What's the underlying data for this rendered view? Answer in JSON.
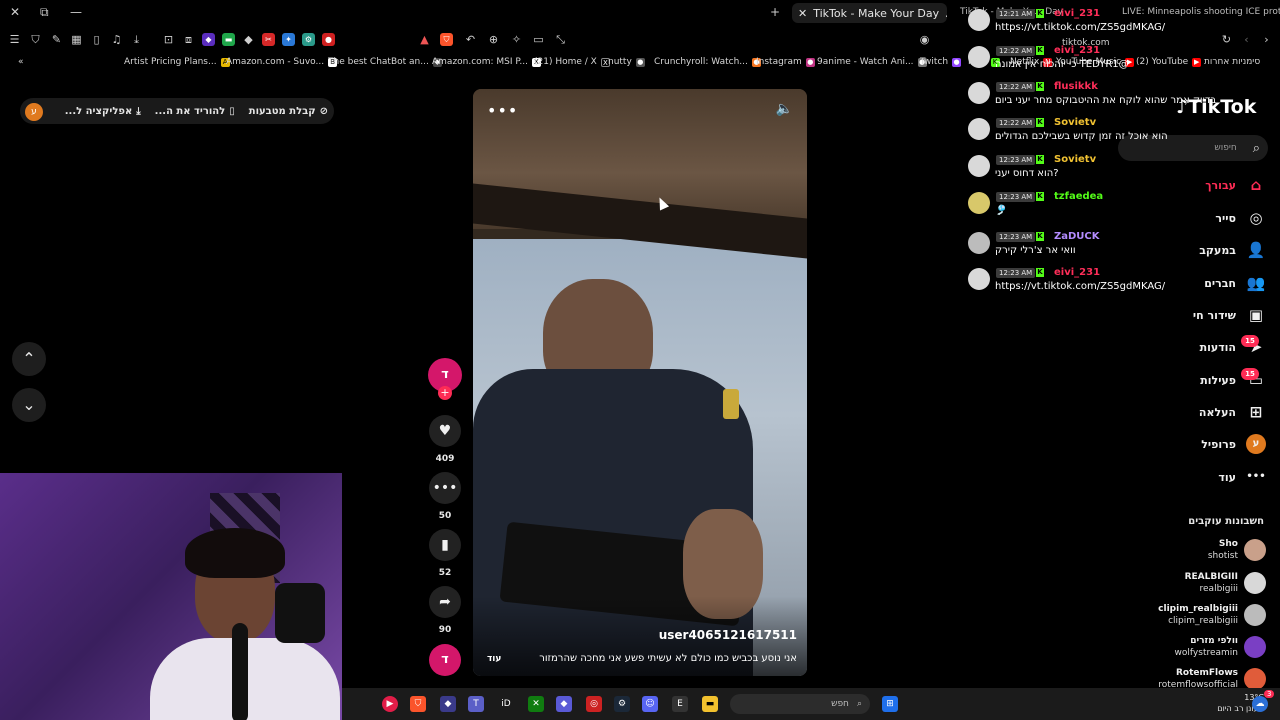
{
  "browser": {
    "active_tab": "TikTok - Make Your Day",
    "other_tabs": [
      "TikTok - Make Your Day",
      "LIVE: Minneapolis shooting ICE protes"
    ],
    "url_domain": "tiktok.com"
  },
  "bookmarks": [
    {
      "label": "Artist Pricing Plans...",
      "color": "#e6b800",
      "glyph": "A"
    },
    {
      "label": "Amazon.com - Suvo...",
      "color": "#ffffff",
      "glyph": "B"
    },
    {
      "label": "The best ChatBot an...",
      "color": "#444444",
      "glyph": "◆"
    },
    {
      "label": "Amazon.com: MSI P...",
      "color": "#ffffff",
      "glyph": "X"
    },
    {
      "label": "(21) Home / X",
      "color": "#000000",
      "glyph": "●"
    },
    {
      "label": "nutty",
      "color": "#555555",
      "glyph": "●"
    },
    {
      "label": "Crunchyroll: Watch...",
      "color": "#f47521",
      "glyph": "●"
    },
    {
      "label": "Instagram",
      "color": "#c13584",
      "glyph": "●"
    },
    {
      "label": "9anime - Watch Ani...",
      "color": "#777777",
      "glyph": "●"
    },
    {
      "label": "Twitch",
      "color": "#9146ff",
      "glyph": "●"
    },
    {
      "label": "Kick",
      "color": "#53fc18",
      "glyph": "K"
    },
    {
      "label": "Netflix",
      "color": "#e50914",
      "glyph": "N"
    },
    {
      "label": "YouTube Music",
      "color": "#ff0000",
      "glyph": "▶"
    },
    {
      "label": "(2) YouTube",
      "color": "#ff0000",
      "glyph": "▶"
    },
    {
      "label": "סימניות אחרות",
      "color": "#777777",
      "glyph": "▤"
    }
  ],
  "top_pill": {
    "items": [
      "קבלת מטבעות",
      "להוריד את ה...",
      "אפליקציה ל..."
    ],
    "avatar_letter": "ע"
  },
  "video": {
    "username": "user4065121617511",
    "caption": "אני נוסע בכביש כמו כולם לא עשיתי פשע אני מחכה שהרמזור",
    "more_label": "עוד",
    "menu_glyph": "•••",
    "sound_glyph": "🔈"
  },
  "actions": {
    "creator_letter": "ד",
    "likes": "409",
    "comments": "50",
    "saves": "52",
    "shares": "90"
  },
  "chat": [
    {
      "time": "12:21 AM",
      "name": "eivi_231",
      "name_color": "#ff2e59",
      "text": "https://vt.tiktok.com/ZS5gdMKAG/"
    },
    {
      "time": "12:22 AM",
      "name": "eivi_231",
      "name_color": "#ff2e59",
      "text": "כי יוהכוח אין אמונה TEDYR1@"
    },
    {
      "time": "12:22 AM",
      "name": "flusikkk",
      "name_color": "#ff2e59",
      "text": "בדיוק אמר שהוא לוקח את ההיטבוקס מחר יעני ביום"
    },
    {
      "time": "12:22 AM",
      "name": "Sovietv",
      "name_color": "#f1c232",
      "text": "הוא אוכל זה זמן קדוש בשבילכם הגדולים"
    },
    {
      "time": "12:23 AM",
      "name": "Sovietv",
      "name_color": "#f1c232",
      "text": "הוא דחוס יעני?"
    },
    {
      "time": "12:23 AM",
      "name": "tzfaedea",
      "name_color": "#53fc18",
      "text": "🎐"
    },
    {
      "time": "12:23 AM",
      "name": "ZaDUCK",
      "name_color": "#b48cff",
      "text": "וואי אר צ'רלי קירק"
    },
    {
      "time": "12:23 AM",
      "name": "eivi_231",
      "name_color": "#ff2e59",
      "text": "https://vt.tiktok.com/ZS5gdMKAG/"
    }
  ],
  "tiktok": {
    "logo": "TikTok",
    "search_placeholder": "חיפוש",
    "nav": [
      {
        "label": "עבורך",
        "icon": "⌂",
        "active": true
      },
      {
        "label": "סייר",
        "icon": "◎"
      },
      {
        "label": "במעקב",
        "icon": "👤"
      },
      {
        "label": "חברים",
        "icon": "👥"
      },
      {
        "label": "שידור חי",
        "icon": "▣"
      },
      {
        "label": "הודעות",
        "icon": "➤",
        "badge": "15"
      },
      {
        "label": "פעילות",
        "icon": "▭",
        "badge": "15"
      },
      {
        "label": "העלאה",
        "icon": "⊞"
      },
      {
        "label": "פרופיל",
        "icon": "ע"
      },
      {
        "label": "עוד",
        "icon": "•••"
      }
    ],
    "following_title": "חשבונות עוקבים",
    "following": [
      {
        "name": "Sho",
        "handle": "shotist",
        "color": "#c9a08a"
      },
      {
        "name": "REALBIGIII",
        "handle": "realbigiii",
        "color": "#d8d8d8"
      },
      {
        "name": "clipim_realbigiii",
        "handle": "clipim_realbigiii",
        "color": "#bbbbbb"
      },
      {
        "name": "וולפי מזרים",
        "handle": "wolfystreamin",
        "color": "#7a3fc4"
      },
      {
        "name": "RotemFlows",
        "handle": "rotemflowsofficial",
        "color": "#e05c3a"
      }
    ]
  },
  "taskbar": {
    "search_placeholder": "חפש",
    "weather_temp": "13°C",
    "weather_text": "מעונן רב היום",
    "notif_count": "3"
  }
}
